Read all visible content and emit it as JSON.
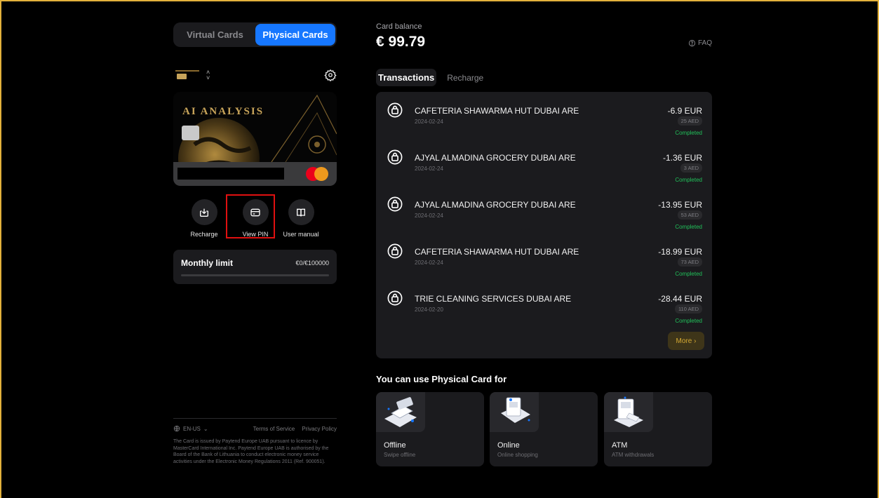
{
  "card_tabs": {
    "virtual": "Virtual Cards",
    "physical": "Physical Cards"
  },
  "card": {
    "brand_text": "AI ANALYSIS",
    "mini_logo_text": "AI ANALYSIS",
    "network": "mastercard"
  },
  "actions": [
    {
      "label": "Recharge",
      "icon": "recharge-icon"
    },
    {
      "label": "View PIN",
      "icon": "cvv-card-icon"
    },
    {
      "label": "User manual",
      "icon": "book-icon"
    }
  ],
  "limit": {
    "title": "Monthly limit",
    "value": "€0/€100000",
    "progress": 0
  },
  "footer": {
    "language": "EN-US",
    "terms": "Terms of Service",
    "privacy": "Privacy Policy",
    "legal": "The Card is issued by Paytend Europe UAB pursuant to licence by MasterCard International Inc. Paytend Europe UAB is authorised by the Board of the Bank of Lithuania to conduct electronic money service activities under the Electronic Money Regulations 2011 (Ref. 900051)."
  },
  "balance": {
    "label": "Card balance",
    "value": "€ 99.79"
  },
  "faq": "FAQ",
  "tabs": {
    "transactions": "Transactions",
    "recharge": "Recharge"
  },
  "transactions": [
    {
      "name": "CAFETERIA SHAWARMA HUT DUBAI ARE",
      "date": "2024-02-24",
      "amount": "-6.9 EUR",
      "local": "25 AED",
      "status": "Completed"
    },
    {
      "name": "AJYAL ALMADINA GROCERY DUBAI ARE",
      "date": "2024-02-24",
      "amount": "-1.36 EUR",
      "local": "3 AED",
      "status": "Completed"
    },
    {
      "name": "AJYAL ALMADINA GROCERY DUBAI ARE",
      "date": "2024-02-24",
      "amount": "-13.95 EUR",
      "local": "53 AED",
      "status": "Completed"
    },
    {
      "name": "CAFETERIA SHAWARMA HUT DUBAI ARE",
      "date": "2024-02-24",
      "amount": "-18.99 EUR",
      "local": "73 AED",
      "status": "Completed"
    },
    {
      "name": "TRIE CLEANING SERVICES DUBAI ARE",
      "date": "2024-02-20",
      "amount": "-28.44 EUR",
      "local": "110 AED",
      "status": "Completed"
    }
  ],
  "more": "More ›",
  "usage": {
    "title": "You can use Physical Card for",
    "items": [
      {
        "title": "Offline",
        "subtitle": "Swipe offline",
        "icon": "pos-terminal-icon"
      },
      {
        "title": "Online",
        "subtitle": "Online shopping",
        "icon": "online-shopping-icon"
      },
      {
        "title": "ATM",
        "subtitle": "ATM withdrawals",
        "icon": "atm-icon"
      }
    ]
  },
  "colors": {
    "accent": "#1677ff",
    "success": "#21c15a",
    "gold": "#c9a55a",
    "highlight": "#e01010",
    "frame": "#e3b23c"
  }
}
